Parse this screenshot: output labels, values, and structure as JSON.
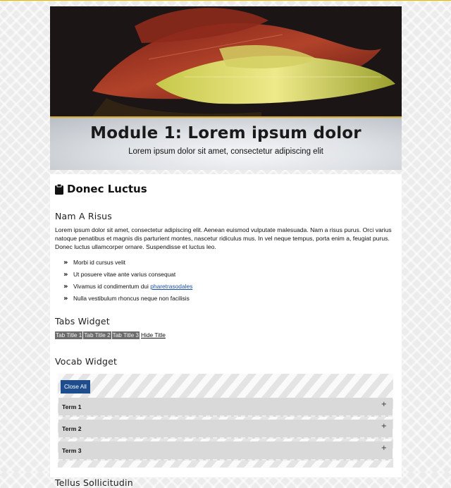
{
  "module": {
    "title": "Module 1: Lorem ipsum dolor",
    "subtitle": "Lorem ipsum dolor sit amet, consectetur adipiscing elit"
  },
  "section": {
    "title": "Donec Luctus",
    "icon": "clipboard-icon"
  },
  "nam": {
    "heading": "Nam A Risus",
    "paragraph": "Lorem ipsum dolor sit amet, consectetur adipiscing elit. Aenean euismod vulputate malesuada. Nam a risus purus. Orci varius natoque penatibus et magnis dis parturient montes, nascetur ridiculus mus. In vel neque tempus, porta enim a, feugiat purus. Donec luctus ullamcorper ornare. Suspendisse et luctus leo.",
    "bullets": [
      {
        "text": "Morbi id cursus velit"
      },
      {
        "text": "Ut posuere vitae ante varius consequat"
      },
      {
        "text": "Vivamus id condimentum dui ",
        "link": "pharetrasodales"
      },
      {
        "text": "Nulla vestibulum rhoncus neque non facilisis"
      }
    ]
  },
  "tabs_widget": {
    "heading": "Tabs Widget",
    "tabs": [
      "Tab Title 1",
      "Tab Title 2",
      "Tab Title 3"
    ],
    "hide_label": "Hide Title"
  },
  "vocab_widget": {
    "heading": "Vocab Widget",
    "close_all": "Close All",
    "terms": [
      "Term 1",
      "Term 2",
      "Term 3"
    ]
  },
  "next_heading": "Tellus Sollicitudin",
  "colors": {
    "accent_gold": "#d6ac2a",
    "button_blue": "#1d4d8c",
    "tab_gray": "#6b6b6b"
  }
}
